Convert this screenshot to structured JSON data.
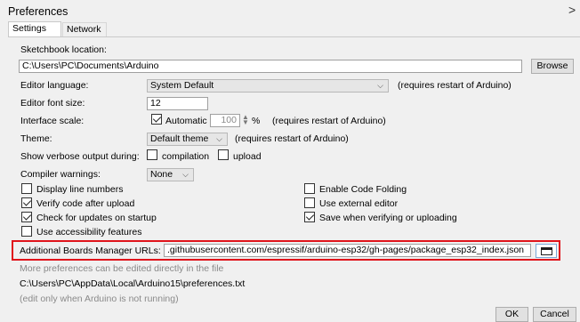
{
  "window": {
    "title": "Preferences",
    "close_glyph": ">"
  },
  "tabs": [
    {
      "label": "Settings",
      "active": true
    },
    {
      "label": "Network",
      "active": false
    }
  ],
  "sketchbook": {
    "label": "Sketchbook location:",
    "value": "C:\\Users\\PC\\Documents\\Arduino",
    "browse_label": "Browse"
  },
  "editor_language": {
    "label": "Editor language:",
    "value": "System Default",
    "note": "(requires restart of Arduino)"
  },
  "editor_font_size": {
    "label": "Editor font size:",
    "value": "12"
  },
  "interface_scale": {
    "label": "Interface scale:",
    "automatic_label": "Automatic",
    "automatic_checked": true,
    "value": "100",
    "unit": "%",
    "note": "(requires restart of Arduino)"
  },
  "theme": {
    "label": "Theme:",
    "value": "Default theme",
    "note": "(requires restart of Arduino)"
  },
  "verbose_output": {
    "label": "Show verbose output during:",
    "compilation_label": "compilation",
    "compilation_checked": false,
    "upload_label": "upload",
    "upload_checked": false
  },
  "compiler_warnings": {
    "label": "Compiler warnings:",
    "value": "None"
  },
  "options_left": [
    {
      "label": "Display line numbers",
      "checked": false
    },
    {
      "label": "Verify code after upload",
      "checked": true
    },
    {
      "label": "Check for updates on startup",
      "checked": true
    },
    {
      "label": "Use accessibility features",
      "checked": false
    }
  ],
  "options_right": [
    {
      "label": "Enable Code Folding",
      "checked": false
    },
    {
      "label": "Use external editor",
      "checked": false
    },
    {
      "label": "Save when verifying or uploading",
      "checked": true
    }
  ],
  "boards_manager": {
    "label": "Additional Boards Manager URLs:",
    "value": ".githubusercontent.com/espressif/arduino-esp32/gh-pages/package_esp32_index.json"
  },
  "more_prefs_note": "More preferences can be edited directly in the file",
  "prefs_path": "C:\\Users\\PC\\AppData\\Local\\Arduino15\\preferences.txt",
  "edit_note": "(edit only when Arduino is not running)",
  "footer": {
    "ok_label": "OK",
    "cancel_label": "Cancel"
  },
  "colors": {
    "highlight_border": "#e0141b",
    "dialog_bg": "#f0f0f0"
  },
  "icons": {
    "folder_button": "folder-icon",
    "dropdown": "chevron-down-icon",
    "checkbox": "check-icon"
  }
}
